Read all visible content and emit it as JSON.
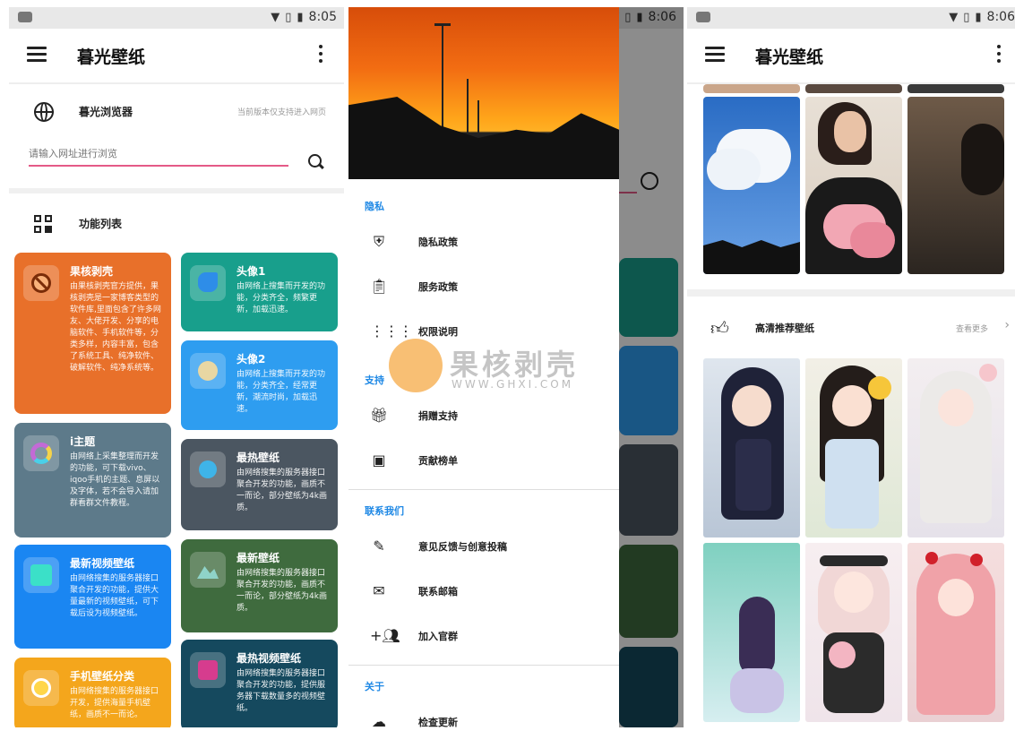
{
  "status_bar": {
    "time_1": "8:05",
    "time_2": "8:06",
    "time_3": "8:06"
  },
  "app": {
    "title": "暮光壁纸"
  },
  "browser": {
    "title": "暮光浏览器",
    "note": "当前版本仅支持进入网页",
    "input_placeholder": "请输入网址进行浏览"
  },
  "functions": {
    "header": "功能列表",
    "cards": [
      {
        "title": "果核剥壳",
        "desc": "由果核剥壳官方提供，果核剥壳是一家博客类型的软件库,里面包含了许多网友、大佬开发、分享的电脑软件、手机软件等，分类多样，内容丰富，包含了系统工具、纯净软件、破解软件、纯净系统等。",
        "color": "#e8702a"
      },
      {
        "title": "头像1",
        "desc": "由网络上搜集而开发的功能，分类齐全，频繁更新，加载迅速。",
        "color": "#189f8c"
      },
      {
        "title": "头像2",
        "desc": "由网络上搜集而开发的功能，分类齐全，经常更新，潮流时尚，加载迅速。",
        "color": "#2e9df0"
      },
      {
        "title": "i主题",
        "desc": "由网络上采集整理而开发的功能，可下载vivo、iqoo手机的主题、息屏以及字体，若不会导入请加群看群文件教程。",
        "color": "#5d7a8a"
      },
      {
        "title": "最热壁纸",
        "desc": "由网络搜集的服务器接口聚合开发的功能，画质不一而论，部分壁纸为4k画质。",
        "color": "#4b5661"
      },
      {
        "title": "最新视频壁纸",
        "desc": "由网络搜集的服务器接口聚合开发的功能，提供大量最新的视频壁纸，可下载后设为视频壁纸。",
        "color": "#1a86f2"
      },
      {
        "title": "最新壁纸",
        "desc": "由网络搜集的服务器接口聚合开发的功能，画质不一而论，部分壁纸为4k画质。",
        "color": "#3f6b3e"
      },
      {
        "title": "手机壁纸分类",
        "desc": "由网络搜集的服务器接口开发，提供海量手机壁纸，画质不一而论。",
        "color": "#f4a61c"
      },
      {
        "title": "最热视频壁纸",
        "desc": "由网络搜集的服务器接口聚合开发的功能，提供服务器下载数量多的视频壁纸。",
        "color": "#15495e"
      }
    ]
  },
  "drawer": {
    "sections": [
      {
        "label": "隐私",
        "items": [
          {
            "icon": "shield-icon",
            "label": "隐私政策"
          },
          {
            "icon": "clipboard-icon",
            "label": "服务政策"
          },
          {
            "icon": "grid-icon",
            "label": "权限说明"
          }
        ]
      },
      {
        "label": "支持",
        "items": [
          {
            "icon": "gift-icon",
            "label": "捐赠支持"
          },
          {
            "icon": "badge-icon",
            "label": "贡献榜单"
          }
        ]
      },
      {
        "label": "联系我们",
        "items": [
          {
            "icon": "feedback-icon",
            "label": "意见反馈与创意投稿"
          },
          {
            "icon": "mail-icon",
            "label": "联系邮箱"
          },
          {
            "icon": "group-add-icon",
            "label": "加入官群"
          }
        ]
      },
      {
        "label": "关于",
        "items": [
          {
            "icon": "cloud-icon",
            "label": "检查更新"
          }
        ]
      }
    ]
  },
  "watermark": {
    "text": "果核剥壳",
    "url": "WWW.GHXI.COM"
  },
  "recommend": {
    "title": "高清推荐壁纸",
    "more": "查看更多",
    "arrow": "›"
  }
}
